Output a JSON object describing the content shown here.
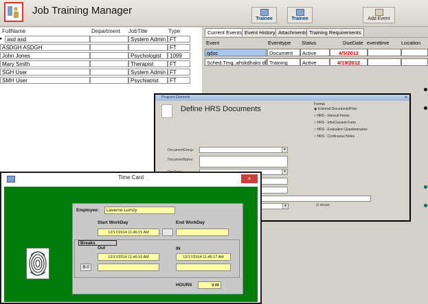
{
  "app": {
    "title": "Job Training Manager",
    "toolbar": [
      {
        "label": "Trainee",
        "icon": "trainee-icon"
      },
      {
        "label": "Trainee",
        "icon": "trainee-icon"
      },
      {
        "label": "Add Event",
        "icon": "event-icon"
      }
    ]
  },
  "employees": {
    "columns": [
      "FullName",
      "Department",
      "JobTitle",
      "Type"
    ],
    "rows": [
      [
        "asd asd",
        "",
        "System Admin",
        "FT"
      ],
      [
        "ASDGH ASDGH",
        "",
        "",
        "FT"
      ],
      [
        "John Jones",
        "",
        "Psychologist",
        "1099"
      ],
      [
        "Mary Smith",
        "",
        "Therapist",
        "FT"
      ],
      [
        "SGH User",
        "",
        "System Admin",
        "FT"
      ],
      [
        "SMH User",
        "",
        "Psychiatrist",
        "FT"
      ]
    ],
    "record_selector": "▸"
  },
  "tabs": [
    "Current Events",
    "Event History",
    "Attachments",
    "Training Requirements"
  ],
  "events": {
    "columns": [
      "Event",
      "Eventtype",
      "Status",
      "DueDate",
      "eventtime",
      "Location"
    ],
    "rows": [
      [
        "qdoc",
        "Document",
        "Active",
        "4/5/2012",
        "",
        ""
      ],
      [
        "Sched.Trng..ahskdhaks dk",
        "Training",
        "Active",
        "4/19/2012",
        "",
        ""
      ]
    ]
  },
  "hrs_dialog": {
    "window_title": "Program Elements",
    "title": "Define HRS Documents",
    "close": "×",
    "format_label": "Format",
    "formats": [
      "External Documents/Files",
      "HRS - Internal Forms",
      "HRS - Info/Consent Form",
      "HRS - Evaluation Questionnaires",
      "HRS - Continuous Notes"
    ],
    "selected_format": 0,
    "fields": [
      "DocumentGroup:",
      "DocumentName:",
      "DocType:"
    ],
    "recurs_label": "recurs"
  },
  "time_card": {
    "title": "Time Card",
    "close": "×",
    "employee_label": "Employee:",
    "employee_name": "Laverne Lumzy",
    "start_label": "Start WorkDay",
    "end_label": "End WorkDay",
    "start_value": "12/17/2014 11:46:15 AM",
    "end_value": "",
    "breaks_label": "Breaks",
    "out_label": "Out",
    "in_label": "IN",
    "break_out_value": "12/17/2014 11:46:16 AM",
    "break_in_value": "12/17/2014 11:46:17 AM",
    "break_code": "B-0",
    "hours_label": "HOURS",
    "hours_value": "0.00"
  }
}
